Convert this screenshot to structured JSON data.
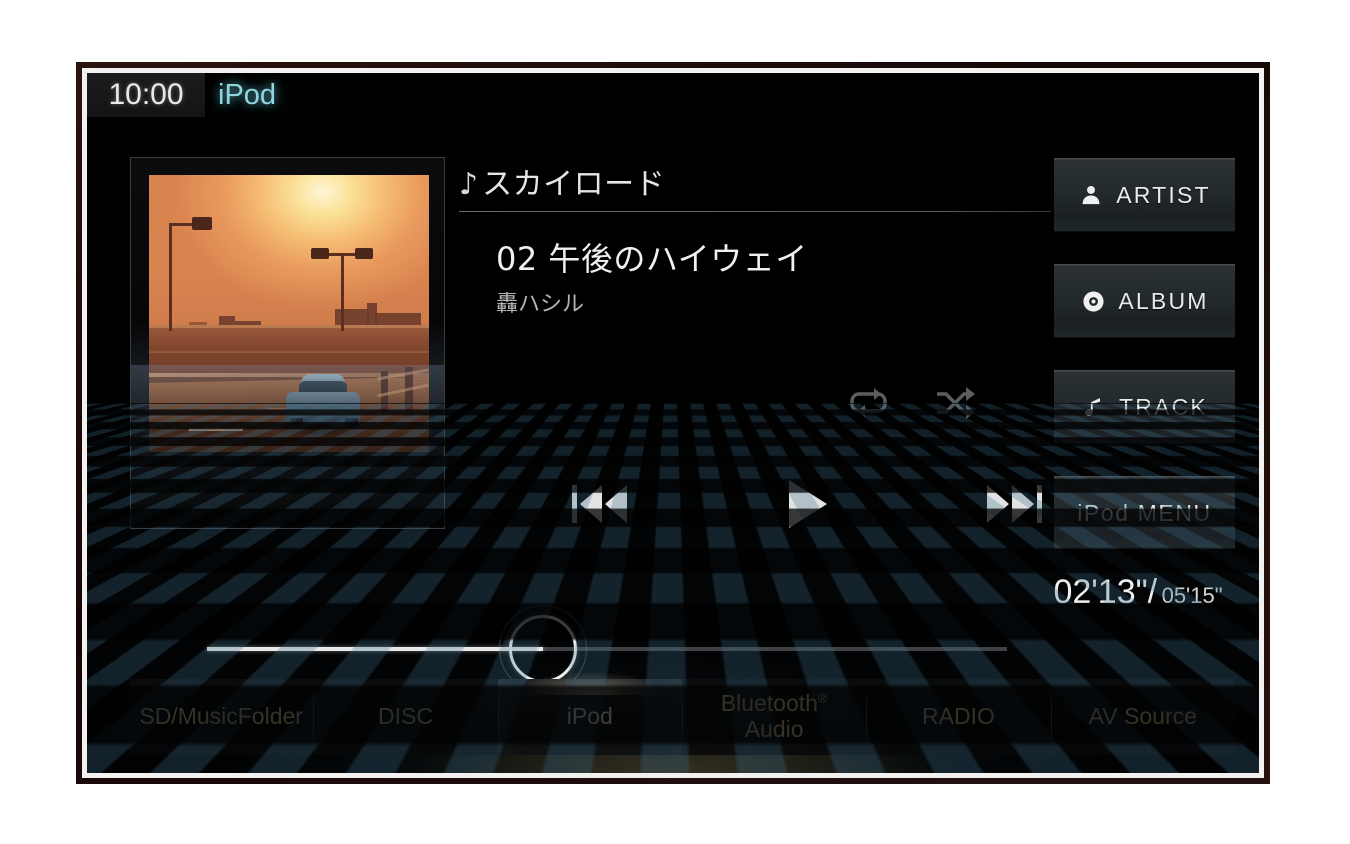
{
  "status_bar": {
    "clock": "10:00",
    "source": "iPod"
  },
  "now_playing": {
    "note_icon": "♪",
    "playlist_name": "スカイロード",
    "track_title": "02 午後のハイウェイ",
    "artist": "轟ハシル",
    "time_current": "02'13\"",
    "time_separator": "/",
    "time_total": "05'15\"",
    "progress_percent": 42
  },
  "album_art": {
    "description": "sunset-highway-photo"
  },
  "mode_icons": [
    {
      "name": "repeat-icon",
      "state": "inactive"
    },
    {
      "name": "shuffle-icon",
      "state": "inactive"
    }
  ],
  "transport": [
    {
      "name": "previous-track-button",
      "label": "Previous"
    },
    {
      "name": "play-button",
      "label": "Play"
    },
    {
      "name": "next-track-button",
      "label": "Next"
    }
  ],
  "side_buttons": [
    {
      "icon": "person-icon",
      "label": "ARTIST"
    },
    {
      "icon": "disc-icon",
      "label": "ALBUM"
    },
    {
      "icon": "music-note-icon",
      "label": "TRACK"
    },
    {
      "icon": null,
      "label": "iPod MENU"
    }
  ],
  "tabs": [
    {
      "label": "SD/MusicFolder",
      "label2": null,
      "superscript": null,
      "active": false
    },
    {
      "label": "DISC",
      "label2": null,
      "superscript": null,
      "active": false
    },
    {
      "label": "iPod",
      "label2": null,
      "superscript": null,
      "active": true
    },
    {
      "label": "Bluetooth",
      "label2": "Audio",
      "superscript": "®",
      "active": false
    },
    {
      "label": "RADIO",
      "label2": null,
      "superscript": null,
      "active": false
    },
    {
      "label": "AV Source",
      "label2": null,
      "superscript": null,
      "active": false
    }
  ],
  "colors": {
    "source_accent": "#8fd6dd",
    "tab_text": "#dcc99a",
    "tab_active_text": "#ffffff",
    "screen_bg": "#000000",
    "mode_icon_inactive": "#5b5d5f"
  }
}
